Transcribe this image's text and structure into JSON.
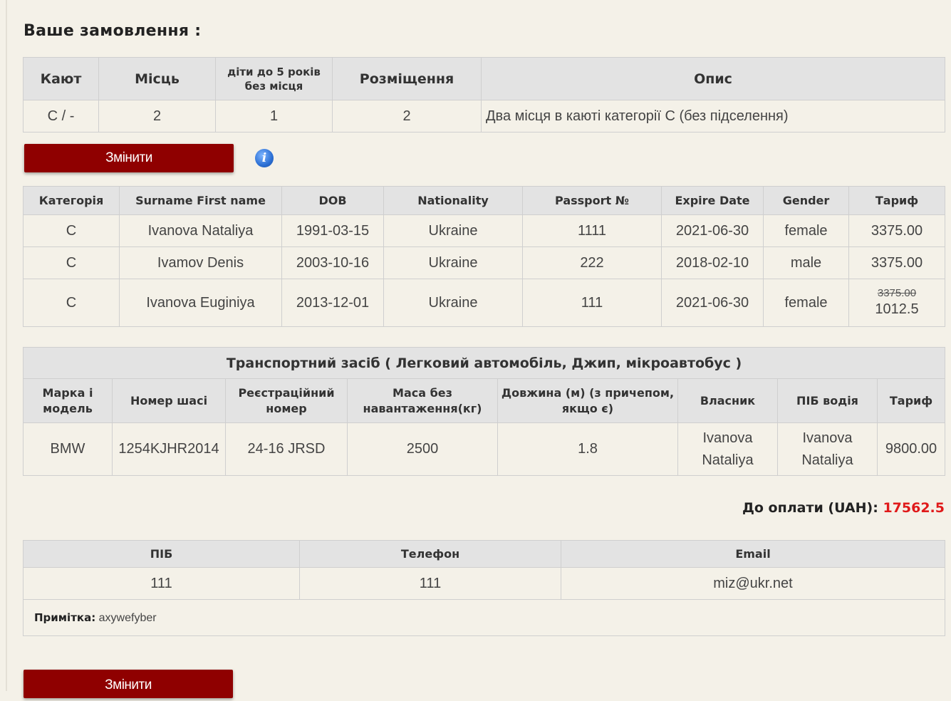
{
  "order": {
    "title": "Ваше замовлення :"
  },
  "cabin_table": {
    "headers": [
      "Кают",
      "Місць",
      "діти до 5 років без місця",
      "Розміщення",
      "Опис"
    ],
    "row": [
      "C / -",
      "2",
      "1",
      "2",
      "Два місця в каюті категорії C (без підселення)"
    ]
  },
  "buttons": {
    "change": "Змінити"
  },
  "icons": {
    "info": "info-icon"
  },
  "passengers": {
    "headers": [
      "Категорія",
      "Surname First name",
      "DOB",
      "Nationality",
      "Passport №",
      "Expire Date",
      "Gender",
      "Тариф"
    ],
    "rows": [
      [
        "C",
        "Ivanova Nataliya",
        "1991-03-15",
        "Ukraine",
        "1111",
        "2021-06-30",
        "female",
        "3375.00"
      ],
      [
        "C",
        "Ivamov Denis",
        "2003-10-16",
        "Ukraine",
        "222",
        "2018-02-10",
        "male",
        "3375.00"
      ],
      [
        "C",
        "Ivanova Euginiya",
        "2013-12-01",
        "Ukraine",
        "111",
        "2021-06-30",
        "female",
        "1012.5"
      ]
    ],
    "old_price": "3375.00"
  },
  "vehicle": {
    "title": "Транспортний засіб ( Легковий автомобіль, Джип, мікроавтобус )",
    "headers": [
      "Марка і модель",
      "Номер шасі",
      "Реєстраційний номер",
      "Маса без навантаження(кг)",
      "Довжина (м) (з причепом, якщо є)",
      "Власник",
      "ПІБ водія",
      "Тариф"
    ],
    "row": [
      "BMW",
      "1254KJHR2014",
      "24-16 JRSD",
      "2500",
      "1.8",
      "Ivanova Nataliya",
      "Ivanova Nataliya",
      "9800.00"
    ]
  },
  "total": {
    "label": "До оплати (UAH):",
    "value": "17562.5",
    "value_color": "#e01a1a"
  },
  "contact": {
    "headers": [
      "ПІБ",
      "Телефон",
      "Email"
    ],
    "row": [
      "111",
      "111",
      "miz@ukr.net"
    ],
    "note_label": "Примітка:",
    "note_value": "axywefyber"
  },
  "colors": {
    "button": "#8f0000",
    "background": "#f4f1e8",
    "header": "#e3e3e3"
  }
}
